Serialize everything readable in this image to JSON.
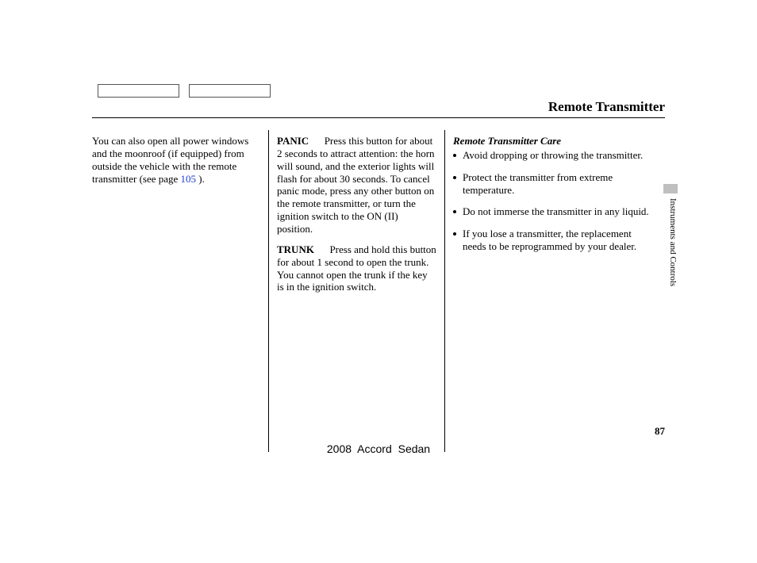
{
  "header": {
    "title": "Remote Transmitter"
  },
  "column1": {
    "p1_a": "You can also open all power windows and the moonroof (if equipped) from outside the vehicle with the remote transmitter (see page ",
    "p1_link": "105",
    "p1_b": " )."
  },
  "column2": {
    "panic_label": "PANIC",
    "panic_gap": " — ",
    "panic_text": "Press this button for about 2 seconds to attract attention: the horn will sound, and the exterior lights will flash for about 30 seconds. To cancel panic mode, press any other button on the remote transmitter, or turn the ignition switch to the ON (II) position.",
    "trunk_label": "TRUNK",
    "trunk_gap": " — ",
    "trunk_text": "Press and hold this button for about 1 second to open the trunk. You cannot open the trunk if the key is in the ignition switch."
  },
  "column3": {
    "care_heading": "Remote Transmitter Care",
    "bullets": [
      "Avoid dropping or throwing the transmitter.",
      "Protect the transmitter from extreme temperature.",
      "Do not immerse the transmitter in any liquid.",
      "If you lose a transmitter, the replacement needs to be reprogrammed by your dealer."
    ]
  },
  "side": {
    "section_label": "Instruments and Controls"
  },
  "footer": {
    "page_number": "87",
    "model": "2008  Accord  Sedan"
  }
}
